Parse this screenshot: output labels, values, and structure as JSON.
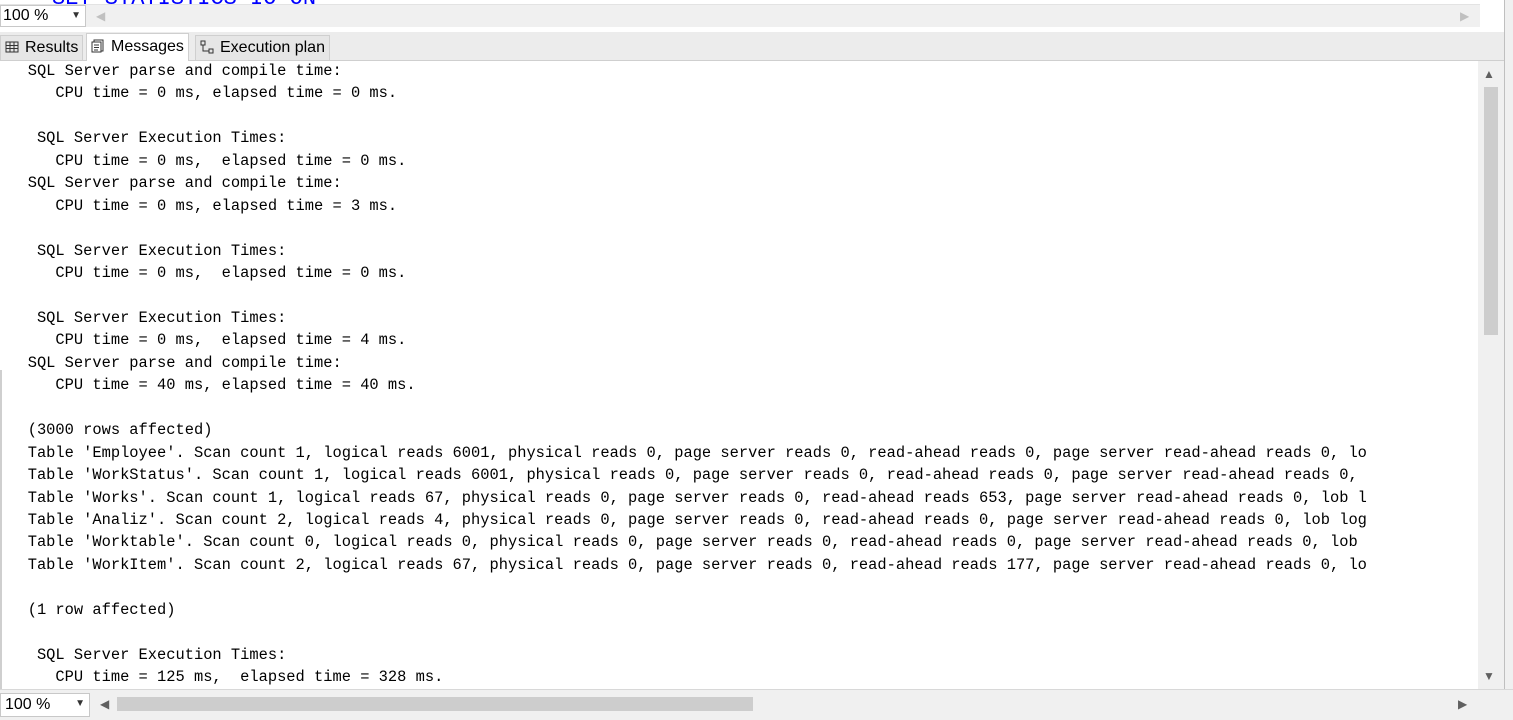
{
  "editor": {
    "code_fragment": "SET STATISTICS IO ON"
  },
  "top_zoom": {
    "value": "100 %"
  },
  "tabs": [
    {
      "label": "Results",
      "icon": "grid-icon",
      "active": false
    },
    {
      "label": "Messages",
      "icon": "messages-icon",
      "active": true
    },
    {
      "label": "Execution plan",
      "icon": "execution-plan-icon",
      "active": false
    }
  ],
  "messages": [
    "   SQL Server parse and compile time: ",
    "      CPU time = 0 ms, elapsed time = 0 ms.",
    "",
    "    SQL Server Execution Times:",
    "      CPU time = 0 ms,  elapsed time = 0 ms.",
    "   SQL Server parse and compile time: ",
    "      CPU time = 0 ms, elapsed time = 3 ms.",
    "",
    "    SQL Server Execution Times:",
    "      CPU time = 0 ms,  elapsed time = 0 ms.",
    "",
    "    SQL Server Execution Times:",
    "      CPU time = 0 ms,  elapsed time = 4 ms.",
    "   SQL Server parse and compile time: ",
    "      CPU time = 40 ms, elapsed time = 40 ms.",
    "",
    "   (3000 rows affected)",
    "   Table 'Employee'. Scan count 1, logical reads 6001, physical reads 0, page server reads 0, read-ahead reads 0, page server read-ahead reads 0, lo",
    "   Table 'WorkStatus'. Scan count 1, logical reads 6001, physical reads 0, page server reads 0, read-ahead reads 0, page server read-ahead reads 0,",
    "   Table 'Works'. Scan count 1, logical reads 67, physical reads 0, page server reads 0, read-ahead reads 653, page server read-ahead reads 0, lob l",
    "   Table 'Analiz'. Scan count 2, logical reads 4, physical reads 0, page server reads 0, read-ahead reads 0, page server read-ahead reads 0, lob log",
    "   Table 'Worktable'. Scan count 0, logical reads 0, physical reads 0, page server reads 0, read-ahead reads 0, page server read-ahead reads 0, lob",
    "   Table 'WorkItem'. Scan count 2, logical reads 67, physical reads 0, page server reads 0, read-ahead reads 177, page server read-ahead reads 0, lo",
    "",
    "   (1 row affected)",
    "",
    "    SQL Server Execution Times:",
    "      CPU time = 125 ms,  elapsed time = 328 ms."
  ],
  "bottom_zoom": {
    "value": "100 %"
  },
  "colors": {
    "keyword_blue": "#0000ff",
    "tab_active": "#ffffff",
    "chrome": "#f0f0f0"
  }
}
